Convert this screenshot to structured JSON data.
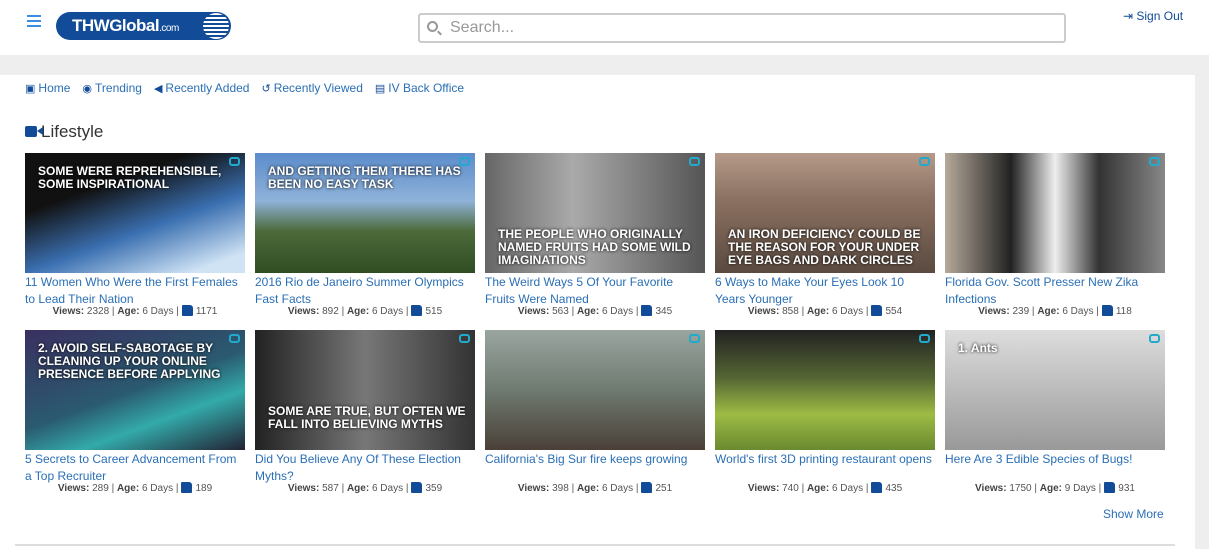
{
  "header": {
    "logo_text": "THWGlobal",
    "logo_suffix": ".com",
    "search_placeholder": "Search...",
    "sign_out": "Sign Out"
  },
  "nav": [
    {
      "label": "Home",
      "icon": "file-video-icon"
    },
    {
      "label": "Trending",
      "icon": "eye-icon"
    },
    {
      "label": "Recently Added",
      "icon": "bullhorn-icon"
    },
    {
      "label": "Recently Viewed",
      "icon": "history-icon"
    },
    {
      "label": "IV Back Office",
      "icon": "list-alt-icon"
    }
  ],
  "section": {
    "title": "Lifestyle",
    "icon": "video-camera-icon"
  },
  "meta_labels": {
    "views": "Views:",
    "age": "Age:"
  },
  "videos": [
    {
      "title": "11 Women Who Were the First Females to Lead Their Nation",
      "overlay": "SOME WERE REPREHENSIBLE, SOME INSPIRATIONAL",
      "views": "2328",
      "age": "6 Days",
      "likes": "1171",
      "bg": "linear-gradient(160deg,#111 30%,#3a6fb0 60%,#cfe3f5 90%)"
    },
    {
      "title": "2016 Rio de Janeiro Summer Olympics Fast Facts",
      "overlay": "AND GETTING THEM THERE HAS BEEN NO EASY TASK",
      "views": "892",
      "age": "6 Days",
      "likes": "515",
      "bg": "linear-gradient(180deg,#5b8ccc 0%,#8fb2d8 40%,#4c6a3a 65%,#2f4d22 100%)"
    },
    {
      "title": "The Weird Ways 5 Of Your Favorite Fruits Were Named",
      "overlay": "THE PEOPLE WHO ORIGINALLY NAMED FRUITS HAD SOME WILD IMAGINATIONS",
      "views": "563",
      "age": "6 Days",
      "likes": "345",
      "bg": "linear-gradient(90deg,#666,#aaa 40%,#555)"
    },
    {
      "title": "6 Ways to Make Your Eyes Look 10 Years Younger",
      "overlay": "AN IRON DEFICIENCY COULD BE THE REASON FOR YOUR UNDER EYE BAGS AND DARK CIRCLES",
      "views": "858",
      "age": "6 Days",
      "likes": "554",
      "bg": "linear-gradient(180deg,#b59a8a,#8a7060 40%,#5a4a40)"
    },
    {
      "title": "Florida Gov. Scott Presser New Zika Infections",
      "overlay": "",
      "views": "239",
      "age": "6 Days",
      "likes": "118",
      "bg": "linear-gradient(90deg,#b5a99a,#222 30%,#eee 50%,#333 70%,#888)"
    },
    {
      "title": "5 Secrets to Career Advancement From a Top Recruiter",
      "overlay": "2. AVOID SELF-SABOTAGE BY CLEANING UP YOUR ONLINE PRESENCE BEFORE APPLYING",
      "views": "289",
      "age": "6 Days",
      "likes": "189",
      "bg": "linear-gradient(160deg,#3a3060,#2a5a70 50%,#3aa 70%,#223)"
    },
    {
      "title": "Did You Believe Any Of These Election Myths?",
      "overlay": "SOME ARE TRUE, BUT OFTEN WE FALL INTO BELIEVING MYTHS",
      "views": "587",
      "age": "6 Days",
      "likes": "359",
      "bg": "linear-gradient(90deg,#222,#777 50%,#333)"
    },
    {
      "title": "California's Big Sur fire keeps growing",
      "overlay": "",
      "views": "398",
      "age": "6 Days",
      "likes": "251",
      "bg": "linear-gradient(180deg,#9aa5a0,#6f7a70 50%,#4a4038)"
    },
    {
      "title": "World's first 3D printing restaurant opens",
      "overlay": "",
      "views": "740",
      "age": "6 Days",
      "likes": "435",
      "bg": "linear-gradient(180deg,#222 0%,#556633 40%,#9dbb44 70%,#6a8a30)"
    },
    {
      "title": "Here Are 3 Edible Species of Bugs!",
      "overlay": "1. Ants",
      "views": "1750",
      "age": "9 Days",
      "likes": "931",
      "bg": "linear-gradient(180deg,#ddd,#bbb 50%,#999)"
    }
  ],
  "show_more": "Show More"
}
